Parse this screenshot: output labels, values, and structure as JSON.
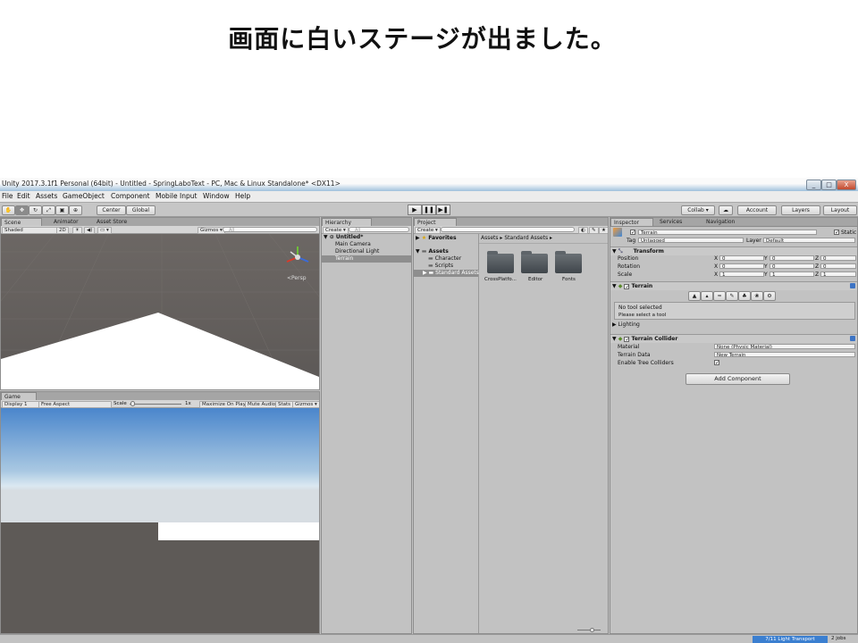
{
  "slide": {
    "title": "画面に白いステージが出ました。"
  },
  "window": {
    "title": "Unity 2017.3.1f1 Personal (64bit) - Untitled - SpringLaboText - PC, Mac & Linux Standalone* <DX11>",
    "minimize": "_",
    "maximize": "□",
    "close": "X"
  },
  "menu": [
    "File",
    "Edit",
    "Assets",
    "GameObject",
    "Component",
    "Mobile Input",
    "Window",
    "Help"
  ],
  "toolbar": {
    "center": "Center",
    "global": "Global",
    "play": "▶",
    "pause": "❚❚",
    "step": "▶❚",
    "collab": "Collab ▾",
    "cloud": "☁",
    "account": "Account",
    "layers": "Layers",
    "layout": "Layout"
  },
  "scene": {
    "tabs": [
      "Scene",
      "Animator",
      "Asset Store"
    ],
    "shading": "Shaded",
    "mode2d": "2D",
    "gizmos": "Gizmos ▾",
    "search": "All",
    "persp": "<Persp",
    "colors": {
      "ground": "#5c5856",
      "sky_top": "#8aa2b4",
      "plane": "#ffffff"
    }
  },
  "game": {
    "tab": "Game",
    "display": "Display 1",
    "aspect": "Free Aspect",
    "scale_label": "Scale",
    "scale_value": "1x",
    "maximize": "Maximize On Play",
    "mute": "Mute Audio",
    "stats": "Stats",
    "gizmos": "Gizmos ▾",
    "colors": {
      "sky": "#4a86cc",
      "horizon": "#dbe8f1",
      "ground": "#5e5a57"
    }
  },
  "hierarchy": {
    "tab": "Hierarchy",
    "create": "Create ▾",
    "search": "All",
    "scene_name": "Untitled*",
    "items": [
      "Main Camera",
      "Directional Light",
      "Terrain"
    ],
    "selected": "Terrain"
  },
  "project": {
    "tab": "Project",
    "create": "Create ▾",
    "favorites": "Favorites",
    "assets_root": "Assets",
    "tree": [
      "Character",
      "Scripts",
      "Standard Assets"
    ],
    "breadcrumb": "Assets ▸ Standard Assets ▸",
    "folders": [
      "CrossPlatfo...",
      "Editor",
      "Fonts"
    ]
  },
  "inspector": {
    "tabs": [
      "Inspector",
      "Services",
      "Navigation"
    ],
    "object_name": "Terrain",
    "static_label": "Static",
    "tag_label": "Tag",
    "tag_value": "Untagged",
    "layer_label": "Layer",
    "layer_value": "Default",
    "transform": {
      "title": "Transform",
      "rows": [
        {
          "label": "Position",
          "x": "0",
          "y": "0",
          "z": "0"
        },
        {
          "label": "Rotation",
          "x": "0",
          "y": "0",
          "z": "0"
        },
        {
          "label": "Scale",
          "x": "1",
          "y": "1",
          "z": "1"
        }
      ]
    },
    "terrain": {
      "title": "Terrain",
      "msg1": "No tool selected",
      "msg2": "Please select a tool",
      "lighting": "Lighting"
    },
    "collider": {
      "title": "Terrain Collider",
      "material_label": "Material",
      "material_value": "None (Physic Material)",
      "data_label": "Terrain Data",
      "data_value": "New Terrain",
      "trees_label": "Enable Tree Colliders"
    },
    "add_component": "Add Component"
  },
  "status": {
    "progress": "7/11 Light Transport",
    "jobs": "2 jobs"
  }
}
